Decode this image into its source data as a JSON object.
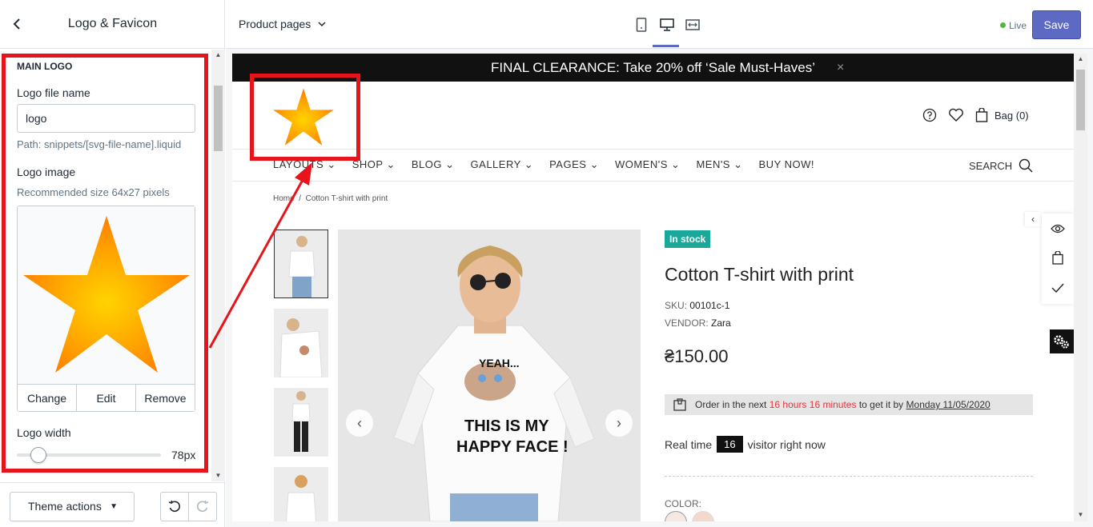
{
  "sidebar": {
    "title": "Logo & Favicon",
    "section_title": "MAIN LOGO",
    "file_name_label": "Logo file name",
    "file_name_value": "logo",
    "file_name_help": "Path: snippets/[svg-file-name].liquid",
    "image_label": "Logo image",
    "image_help": "Recommended size 64x27 pixels",
    "image_actions": {
      "change": "Change",
      "edit": "Edit",
      "remove": "Remove"
    },
    "width_label": "Logo width",
    "width_value": "78px",
    "width_slider_level": 0.15,
    "footer": {
      "theme_actions": "Theme actions"
    }
  },
  "topbar": {
    "page_select": "Product pages",
    "status": "Live",
    "save": "Save",
    "status_color": "#50b83c",
    "accent": "#5c6ac4"
  },
  "store": {
    "announcement": "FINAL CLEARANCE: Take 20% off ‘Sale Must-Haves’",
    "announcement_close": "×",
    "bag": "Bag (0)",
    "nav": [
      "LAYOUTS",
      "SHOP",
      "BLOG",
      "GALLERY",
      "PAGES",
      "WOMEN'S",
      "MEN'S",
      "BUY NOW!"
    ],
    "search": "SEARCH",
    "breadcrumb": {
      "home": "Home",
      "sep": "/",
      "current": "Cotton T-shirt with print"
    },
    "product": {
      "badge": "In stock",
      "title": "Cotton T-shirt with print",
      "sku_label": "SKU:",
      "sku": "00101c-1",
      "vendor_label": "VENDOR:",
      "vendor": "Zara",
      "price": "₴150.00",
      "order_prefix": "Order in the next",
      "order_time": "16 hours 16 minutes",
      "order_mid": "to get it by",
      "order_date": "Monday 11/05/2020",
      "realtime_prefix": "Real time",
      "realtime_count": "16",
      "realtime_suffix": "visitor right now",
      "color_label": "COLOR:",
      "shirt_text_1": "YEAH...",
      "shirt_text_2": "THIS IS MY",
      "shirt_text_3": "HAPPY FACE !"
    },
    "badge_color": "#1aa89a",
    "highlight_color": "#e8141b"
  }
}
